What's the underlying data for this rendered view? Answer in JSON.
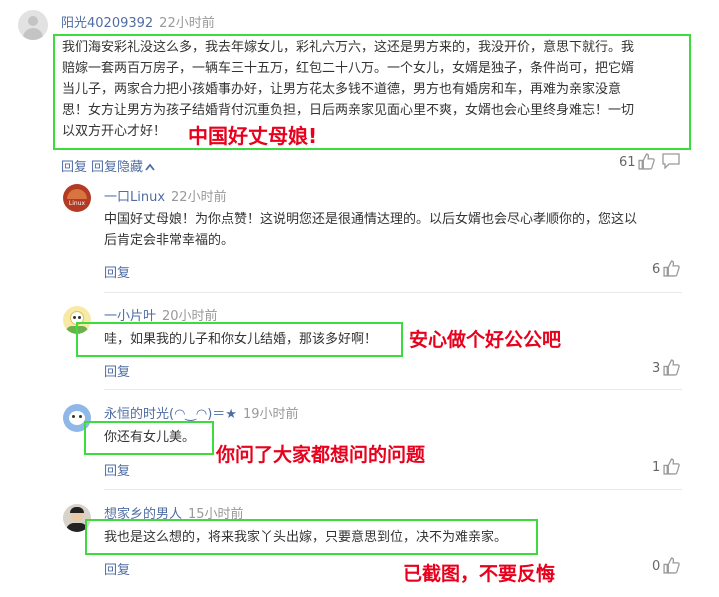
{
  "comments": [
    {
      "user": "阳光40209392",
      "time": "22小时前",
      "lines": [
        "我们海安彩礼没这么多，我去年嫁女儿，彩礼六万六，这还是男方来的，我没开价，意思下就行。我",
        "赔嫁一套两百万房子，一辆车三十五万，红包二十八万。一个女儿，女婿是独子，条件尚可，把它婿",
        "当儿子，两家合力把小孩婚事办好，让男方花太多钱不道德，男方也有婚房和车，再难为亲家没意",
        "思！女方让男方为孩子结婚背付沉重负担，日后两亲家见面心里不爽，女婿也会心里终身难忘！一切",
        "以双方开心才好！"
      ],
      "reply": "回复",
      "hide_replies": "回复隐藏",
      "likes": "61",
      "annotation": "中国好丈母娘!"
    },
    {
      "user": "一口Linux",
      "time": "22小时前",
      "lines": [
        "中国好丈母娘！为你点赞！这说明您还是很通情达理的。以后女婿也会尽心孝顺你的，您这以",
        "后肯定会非常幸福的。"
      ],
      "reply": "回复",
      "likes": "6"
    },
    {
      "user": "一小片叶",
      "time": "20小时前",
      "lines": [
        "哇，如果我的儿子和你女儿结婚，那该多好啊！"
      ],
      "reply": "回复",
      "likes": "3",
      "annotation": "安心做个好公公吧"
    },
    {
      "user": "永恒的时光(◠‿◠)＝★",
      "time": "19小时前",
      "lines": [
        "你还有女儿美。"
      ],
      "reply": "回复",
      "likes": "1",
      "annotation": "你问了大家都想问的问题"
    },
    {
      "user": "想家乡的男人",
      "time": "15小时前",
      "lines": [
        "我也是这么想的，将来我家丫头出嫁，只要意思到位，决不为难亲家。"
      ],
      "reply": "回复",
      "likes": "0",
      "annotation": "已截图，不要反悔"
    }
  ],
  "avatar_logo_text": "Linux",
  "colors": {
    "highlight": "#3ddb3d",
    "annotation": "#e8001c",
    "link": "#4f6da4"
  }
}
